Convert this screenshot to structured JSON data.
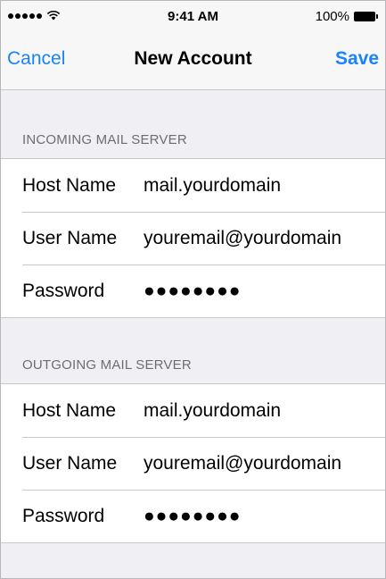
{
  "status_bar": {
    "signal": "●●●●●",
    "wifi_icon": "wifi-icon",
    "time": "9:41 AM",
    "battery": "100%",
    "battery_level": 1.0
  },
  "nav": {
    "cancel_label": "Cancel",
    "title": "New Account",
    "save_label": "Save"
  },
  "incoming": {
    "header": "INCOMING MAIL SERVER",
    "rows": [
      {
        "label": "Host Name",
        "value": "mail.yourdomain"
      },
      {
        "label": "User Name",
        "value": "youremail@yourdomain"
      },
      {
        "label": "Password",
        "value": "●●●●●●●●"
      }
    ]
  },
  "outgoing": {
    "header": "OUTGOING MAIL SERVER",
    "rows": [
      {
        "label": "Host Name",
        "value": "mail.yourdomain"
      },
      {
        "label": "User Name",
        "value": "youremail@yourdomain"
      },
      {
        "label": "Password",
        "value": "●●●●●●●●"
      }
    ]
  },
  "colors": {
    "accent": "#1a82fb",
    "background": "#efeff4",
    "separator": "#c8c7cc",
    "section_header": "#6d6d72"
  }
}
